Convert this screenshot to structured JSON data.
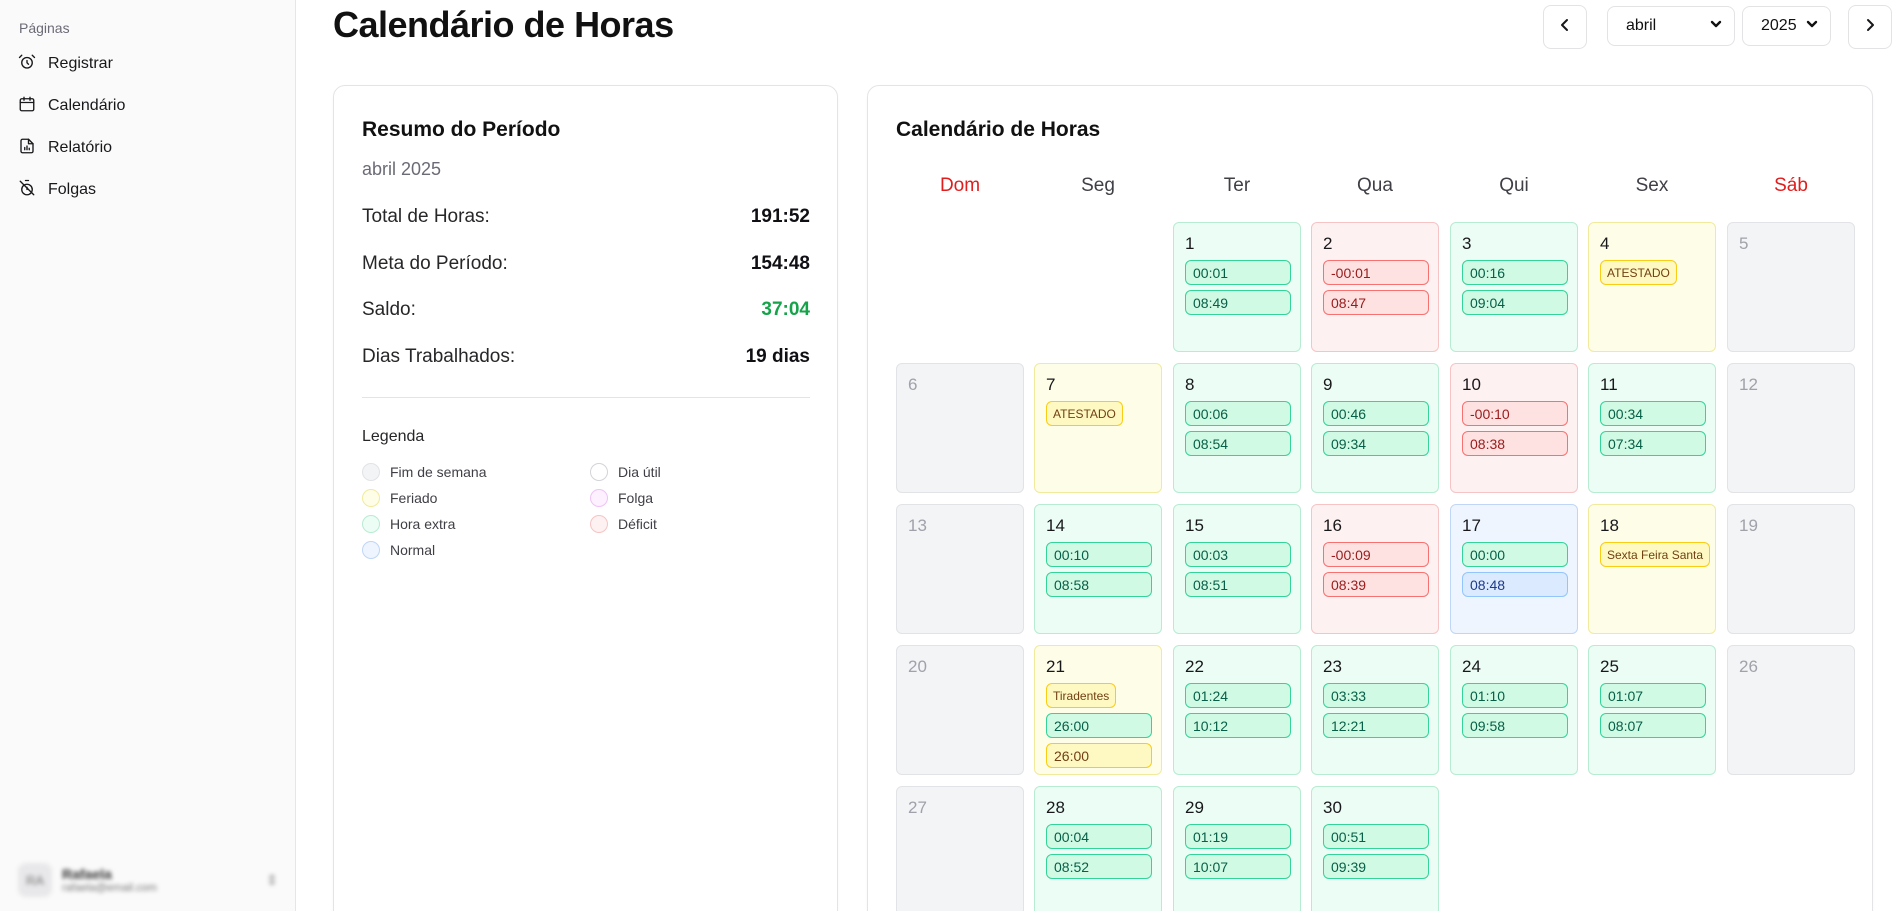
{
  "sidebar": {
    "group_label": "Páginas",
    "items": [
      {
        "label": "Registrar",
        "icon": "alarm-clock-icon"
      },
      {
        "label": "Calendário",
        "icon": "calendar-icon"
      },
      {
        "label": "Relatório",
        "icon": "file-chart-icon"
      },
      {
        "label": "Folgas",
        "icon": "timer-off-icon"
      }
    ],
    "user": {
      "initials": "RA",
      "name": "Rafaela",
      "email": "rafaela@email.com"
    }
  },
  "header": {
    "title": "Calendário de Horas",
    "month_value": "abril",
    "year_value": "2025"
  },
  "summary": {
    "title": "Resumo do Período",
    "period": "abril 2025",
    "stats": [
      {
        "label": "Total de Horas:",
        "value": "191:52"
      },
      {
        "label": "Meta do Período:",
        "value": "154:48"
      },
      {
        "label": "Saldo:",
        "value": "37:04"
      },
      {
        "label": "Dias Trabalhados:",
        "value": "19 dias"
      }
    ],
    "legend_title": "Legenda",
    "legend": [
      {
        "label": "Fim de semana",
        "color": "#f3f4f6"
      },
      {
        "label": "Dia útil",
        "color": "#ffffff"
      },
      {
        "label": "Feriado",
        "color": "#fefde8"
      },
      {
        "label": "Folga",
        "color": "#fdf0ff"
      },
      {
        "label": "Hora extra",
        "color": "#ecfdf5"
      },
      {
        "label": "Déficit",
        "color": "#fef1f1"
      },
      {
        "label": "Normal",
        "color": "#eef5ff"
      }
    ]
  },
  "calendar": {
    "title": "Calendário de Horas",
    "weekdays": [
      "Dom",
      "Seg",
      "Ter",
      "Qua",
      "Qui",
      "Sex",
      "Sáb"
    ],
    "days": [
      {
        "d": "1",
        "type": "extra",
        "balance": "00:01",
        "worked": "08:49"
      },
      {
        "d": "2",
        "type": "deficit",
        "balance": "-00:01",
        "worked": "08:47"
      },
      {
        "d": "3",
        "type": "extra",
        "balance": "00:16",
        "worked": "09:04"
      },
      {
        "d": "4",
        "type": "holiday",
        "tag": "ATESTADO"
      },
      {
        "d": "5",
        "type": "weekend"
      },
      {
        "d": "6",
        "type": "weekend"
      },
      {
        "d": "7",
        "type": "holiday",
        "tag": "ATESTADO"
      },
      {
        "d": "8",
        "type": "extra",
        "balance": "00:06",
        "worked": "08:54"
      },
      {
        "d": "9",
        "type": "extra",
        "balance": "00:46",
        "worked": "09:34"
      },
      {
        "d": "10",
        "type": "deficit",
        "balance": "-00:10",
        "worked": "08:38"
      },
      {
        "d": "11",
        "type": "extra",
        "balance": "00:34",
        "worked": "07:34"
      },
      {
        "d": "12",
        "type": "weekend"
      },
      {
        "d": "13",
        "type": "weekend"
      },
      {
        "d": "14",
        "type": "extra",
        "balance": "00:10",
        "worked": "08:58"
      },
      {
        "d": "15",
        "type": "extra",
        "balance": "00:03",
        "worked": "08:51"
      },
      {
        "d": "16",
        "type": "deficit",
        "balance": "-00:09",
        "worked": "08:39"
      },
      {
        "d": "17",
        "type": "normal",
        "balance": "00:00",
        "worked": "08:48"
      },
      {
        "d": "18",
        "type": "holiday",
        "tag": "Sexta Feira Santa"
      },
      {
        "d": "19",
        "type": "weekend"
      },
      {
        "d": "20",
        "type": "weekend"
      },
      {
        "d": "21",
        "type": "holiday",
        "tag": "Tiradentes",
        "balance": "26:00",
        "worked": "26:00"
      },
      {
        "d": "22",
        "type": "extra",
        "balance": "01:24",
        "worked": "10:12"
      },
      {
        "d": "23",
        "type": "extra",
        "balance": "03:33",
        "worked": "12:21"
      },
      {
        "d": "24",
        "type": "extra",
        "balance": "01:10",
        "worked": "09:58"
      },
      {
        "d": "25",
        "type": "extra",
        "balance": "01:07",
        "worked": "08:07"
      },
      {
        "d": "26",
        "type": "weekend"
      },
      {
        "d": "27",
        "type": "weekend"
      },
      {
        "d": "28",
        "type": "extra",
        "balance": "00:04",
        "worked": "08:52"
      },
      {
        "d": "29",
        "type": "extra",
        "balance": "01:19",
        "worked": "10:07"
      },
      {
        "d": "30",
        "type": "extra",
        "balance": "00:51",
        "worked": "09:39"
      }
    ]
  }
}
